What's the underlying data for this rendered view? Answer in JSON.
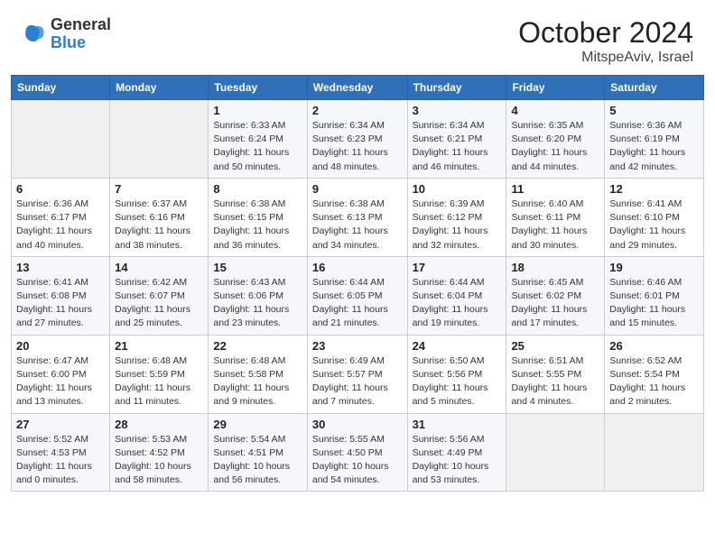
{
  "header": {
    "logo_general": "General",
    "logo_blue": "Blue",
    "month_title": "October 2024",
    "location": "MitspeAviv, Israel"
  },
  "days_of_week": [
    "Sunday",
    "Monday",
    "Tuesday",
    "Wednesday",
    "Thursday",
    "Friday",
    "Saturday"
  ],
  "weeks": [
    [
      {
        "day": "",
        "info": ""
      },
      {
        "day": "",
        "info": ""
      },
      {
        "day": "1",
        "info": "Sunrise: 6:33 AM\nSunset: 6:24 PM\nDaylight: 11 hours and 50 minutes."
      },
      {
        "day": "2",
        "info": "Sunrise: 6:34 AM\nSunset: 6:23 PM\nDaylight: 11 hours and 48 minutes."
      },
      {
        "day": "3",
        "info": "Sunrise: 6:34 AM\nSunset: 6:21 PM\nDaylight: 11 hours and 46 minutes."
      },
      {
        "day": "4",
        "info": "Sunrise: 6:35 AM\nSunset: 6:20 PM\nDaylight: 11 hours and 44 minutes."
      },
      {
        "day": "5",
        "info": "Sunrise: 6:36 AM\nSunset: 6:19 PM\nDaylight: 11 hours and 42 minutes."
      }
    ],
    [
      {
        "day": "6",
        "info": "Sunrise: 6:36 AM\nSunset: 6:17 PM\nDaylight: 11 hours and 40 minutes."
      },
      {
        "day": "7",
        "info": "Sunrise: 6:37 AM\nSunset: 6:16 PM\nDaylight: 11 hours and 38 minutes."
      },
      {
        "day": "8",
        "info": "Sunrise: 6:38 AM\nSunset: 6:15 PM\nDaylight: 11 hours and 36 minutes."
      },
      {
        "day": "9",
        "info": "Sunrise: 6:38 AM\nSunset: 6:13 PM\nDaylight: 11 hours and 34 minutes."
      },
      {
        "day": "10",
        "info": "Sunrise: 6:39 AM\nSunset: 6:12 PM\nDaylight: 11 hours and 32 minutes."
      },
      {
        "day": "11",
        "info": "Sunrise: 6:40 AM\nSunset: 6:11 PM\nDaylight: 11 hours and 30 minutes."
      },
      {
        "day": "12",
        "info": "Sunrise: 6:41 AM\nSunset: 6:10 PM\nDaylight: 11 hours and 29 minutes."
      }
    ],
    [
      {
        "day": "13",
        "info": "Sunrise: 6:41 AM\nSunset: 6:08 PM\nDaylight: 11 hours and 27 minutes."
      },
      {
        "day": "14",
        "info": "Sunrise: 6:42 AM\nSunset: 6:07 PM\nDaylight: 11 hours and 25 minutes."
      },
      {
        "day": "15",
        "info": "Sunrise: 6:43 AM\nSunset: 6:06 PM\nDaylight: 11 hours and 23 minutes."
      },
      {
        "day": "16",
        "info": "Sunrise: 6:44 AM\nSunset: 6:05 PM\nDaylight: 11 hours and 21 minutes."
      },
      {
        "day": "17",
        "info": "Sunrise: 6:44 AM\nSunset: 6:04 PM\nDaylight: 11 hours and 19 minutes."
      },
      {
        "day": "18",
        "info": "Sunrise: 6:45 AM\nSunset: 6:02 PM\nDaylight: 11 hours and 17 minutes."
      },
      {
        "day": "19",
        "info": "Sunrise: 6:46 AM\nSunset: 6:01 PM\nDaylight: 11 hours and 15 minutes."
      }
    ],
    [
      {
        "day": "20",
        "info": "Sunrise: 6:47 AM\nSunset: 6:00 PM\nDaylight: 11 hours and 13 minutes."
      },
      {
        "day": "21",
        "info": "Sunrise: 6:48 AM\nSunset: 5:59 PM\nDaylight: 11 hours and 11 minutes."
      },
      {
        "day": "22",
        "info": "Sunrise: 6:48 AM\nSunset: 5:58 PM\nDaylight: 11 hours and 9 minutes."
      },
      {
        "day": "23",
        "info": "Sunrise: 6:49 AM\nSunset: 5:57 PM\nDaylight: 11 hours and 7 minutes."
      },
      {
        "day": "24",
        "info": "Sunrise: 6:50 AM\nSunset: 5:56 PM\nDaylight: 11 hours and 5 minutes."
      },
      {
        "day": "25",
        "info": "Sunrise: 6:51 AM\nSunset: 5:55 PM\nDaylight: 11 hours and 4 minutes."
      },
      {
        "day": "26",
        "info": "Sunrise: 6:52 AM\nSunset: 5:54 PM\nDaylight: 11 hours and 2 minutes."
      }
    ],
    [
      {
        "day": "27",
        "info": "Sunrise: 5:52 AM\nSunset: 4:53 PM\nDaylight: 11 hours and 0 minutes."
      },
      {
        "day": "28",
        "info": "Sunrise: 5:53 AM\nSunset: 4:52 PM\nDaylight: 10 hours and 58 minutes."
      },
      {
        "day": "29",
        "info": "Sunrise: 5:54 AM\nSunset: 4:51 PM\nDaylight: 10 hours and 56 minutes."
      },
      {
        "day": "30",
        "info": "Sunrise: 5:55 AM\nSunset: 4:50 PM\nDaylight: 10 hours and 54 minutes."
      },
      {
        "day": "31",
        "info": "Sunrise: 5:56 AM\nSunset: 4:49 PM\nDaylight: 10 hours and 53 minutes."
      },
      {
        "day": "",
        "info": ""
      },
      {
        "day": "",
        "info": ""
      }
    ]
  ]
}
